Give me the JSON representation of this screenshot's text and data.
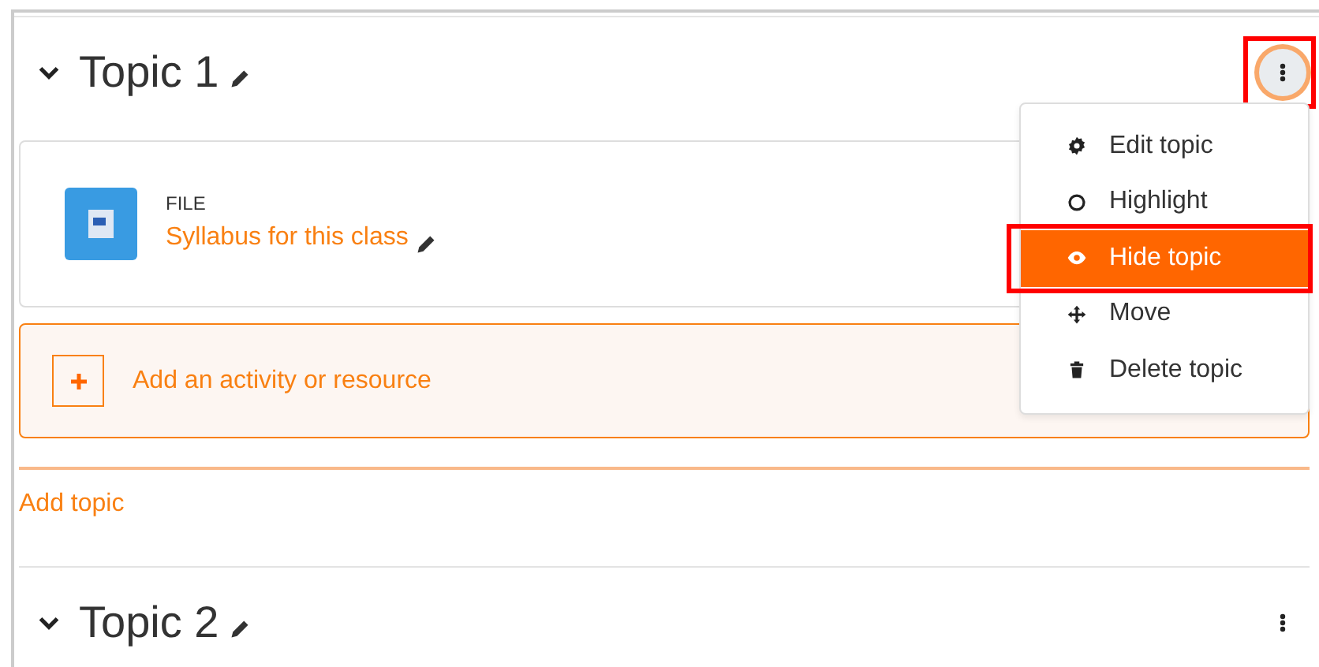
{
  "sections": [
    {
      "title": "Topic 1",
      "expanded": true,
      "menu_button": {
        "focused": true,
        "annotated": true
      },
      "activities": [
        {
          "type": "FILE",
          "name": "Syllabus for this class"
        }
      ],
      "add_activity": "Add an activity or resource"
    },
    {
      "title": "Topic 2",
      "expanded": true,
      "menu_button": {
        "focused": false,
        "annotated": false
      }
    }
  ],
  "add_topic": "Add topic",
  "menu": {
    "items": [
      {
        "kind": "gear",
        "label": "Edit topic",
        "highlighted": false,
        "annotated": false
      },
      {
        "kind": "circle",
        "label": "Highlight",
        "highlighted": false,
        "annotated": false
      },
      {
        "kind": "eye",
        "label": "Hide topic",
        "highlighted": true,
        "annotated": true
      },
      {
        "kind": "move",
        "label": "Move",
        "highlighted": false,
        "annotated": false
      },
      {
        "kind": "trash",
        "label": "Delete topic",
        "highlighted": false,
        "annotated": false
      }
    ]
  }
}
